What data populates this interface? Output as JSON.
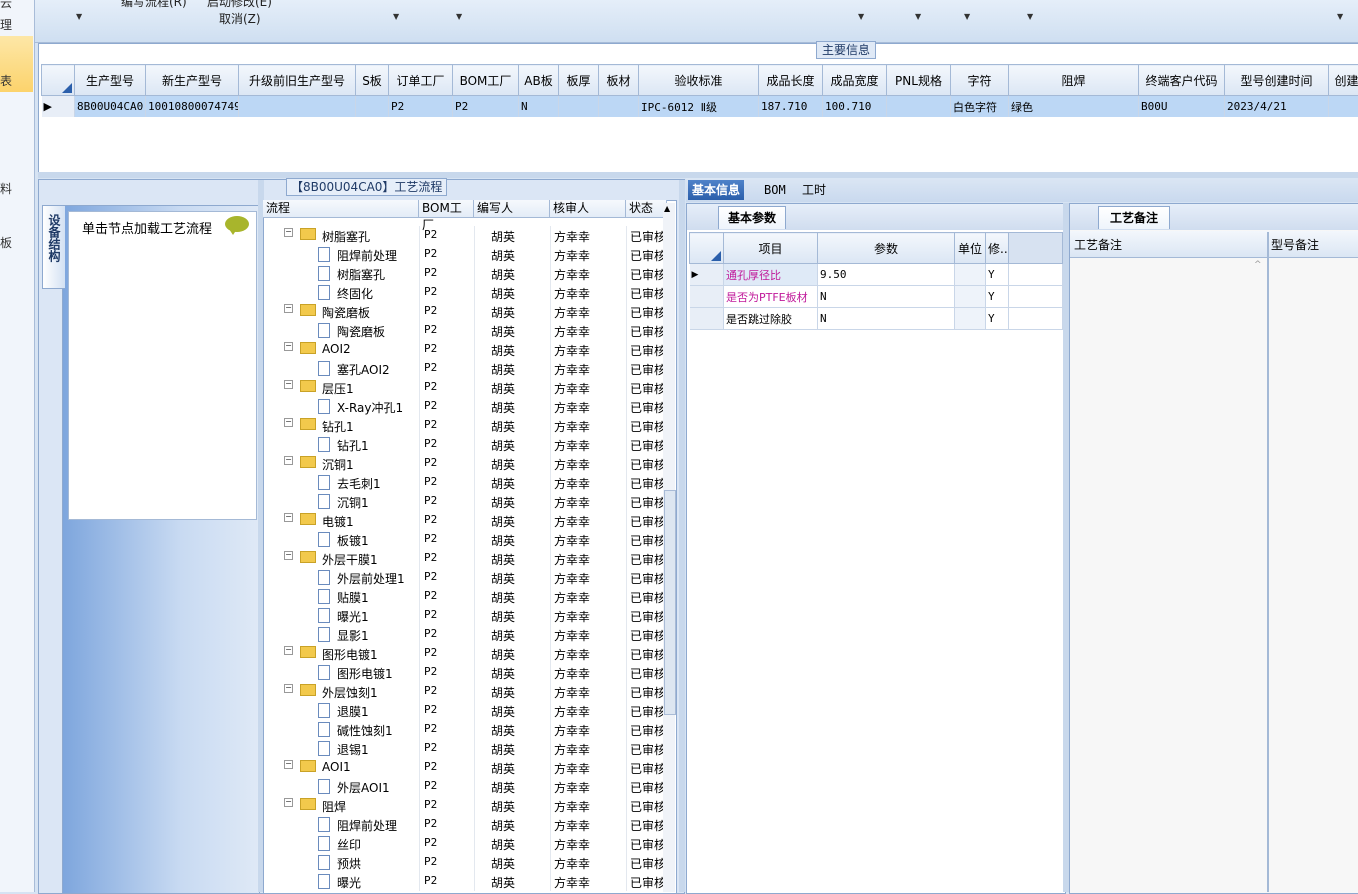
{
  "left_strip": {
    "items": [
      "云",
      "理",
      "表",
      "料",
      "板"
    ]
  },
  "toolbar": {
    "menu_edit_flow": "编写流程(R)",
    "menu_start_review": "启动修改(E)",
    "menu_cancel": "取消(Z)"
  },
  "main_info": {
    "legend": "主要信息",
    "columns": [
      "生产型号",
      "新生产型号",
      "升级前旧生产型号",
      "S板",
      "订单工厂",
      "BOM工厂",
      "AB板",
      "板厚",
      "板材",
      "验收标准",
      "成品长度",
      "成品宽度",
      "PNL规格",
      "字符",
      "阻焊",
      "终端客户代码",
      "型号创建时间",
      "创建"
    ],
    "rows": [
      [
        "8B00U04CA0",
        "10010800074749",
        "",
        "",
        "P2",
        "P2",
        "N",
        "",
        "",
        "IPC-6012 Ⅱ级",
        "187.710",
        "100.710",
        "",
        "白色字符",
        "绿色",
        "B00U",
        "2023/4/21",
        ""
      ]
    ]
  },
  "process": {
    "legend": "【8B00U04CA0】工艺流程",
    "device_tab": "设备结构",
    "device_hint": "单击节点加载工艺流程",
    "columns": [
      "流程",
      "BOM工厂",
      "编写人",
      "核审人",
      "状态"
    ],
    "rows": [
      {
        "type": "folder",
        "name": "树脂塞孔",
        "bom": "P2",
        "writer": "胡英",
        "reviewer": "方幸幸",
        "status": "已审核"
      },
      {
        "type": "file",
        "name": "阻焊前处理",
        "bom": "P2",
        "writer": "胡英",
        "reviewer": "方幸幸",
        "status": "已审核"
      },
      {
        "type": "file",
        "name": "树脂塞孔",
        "bom": "P2",
        "writer": "胡英",
        "reviewer": "方幸幸",
        "status": "已审核"
      },
      {
        "type": "file",
        "name": "终固化",
        "bom": "P2",
        "writer": "胡英",
        "reviewer": "方幸幸",
        "status": "已审核"
      },
      {
        "type": "folder",
        "name": "陶瓷磨板",
        "bom": "P2",
        "writer": "胡英",
        "reviewer": "方幸幸",
        "status": "已审核"
      },
      {
        "type": "file",
        "name": "陶瓷磨板",
        "bom": "P2",
        "writer": "胡英",
        "reviewer": "方幸幸",
        "status": "已审核"
      },
      {
        "type": "folder",
        "name": "AOI2",
        "bom": "P2",
        "writer": "胡英",
        "reviewer": "方幸幸",
        "status": "已审核"
      },
      {
        "type": "file",
        "name": "塞孔AOI2",
        "bom": "P2",
        "writer": "胡英",
        "reviewer": "方幸幸",
        "status": "已审核"
      },
      {
        "type": "folder",
        "name": "层压1",
        "bom": "P2",
        "writer": "胡英",
        "reviewer": "方幸幸",
        "status": "已审核"
      },
      {
        "type": "file",
        "name": "X-Ray冲孔1",
        "bom": "P2",
        "writer": "胡英",
        "reviewer": "方幸幸",
        "status": "已审核"
      },
      {
        "type": "folder",
        "name": "钻孔1",
        "bom": "P2",
        "writer": "胡英",
        "reviewer": "方幸幸",
        "status": "已审核"
      },
      {
        "type": "file",
        "name": "钻孔1",
        "bom": "P2",
        "writer": "胡英",
        "reviewer": "方幸幸",
        "status": "已审核"
      },
      {
        "type": "folder",
        "name": "沉铜1",
        "bom": "P2",
        "writer": "胡英",
        "reviewer": "方幸幸",
        "status": "已审核"
      },
      {
        "type": "file",
        "name": "去毛刺1",
        "bom": "P2",
        "writer": "胡英",
        "reviewer": "方幸幸",
        "status": "已审核"
      },
      {
        "type": "file",
        "name": "沉铜1",
        "bom": "P2",
        "writer": "胡英",
        "reviewer": "方幸幸",
        "status": "已审核"
      },
      {
        "type": "folder",
        "name": "电镀1",
        "bom": "P2",
        "writer": "胡英",
        "reviewer": "方幸幸",
        "status": "已审核"
      },
      {
        "type": "file",
        "name": "板镀1",
        "bom": "P2",
        "writer": "胡英",
        "reviewer": "方幸幸",
        "status": "已审核"
      },
      {
        "type": "folder",
        "name": "外层干膜1",
        "bom": "P2",
        "writer": "胡英",
        "reviewer": "方幸幸",
        "status": "已审核"
      },
      {
        "type": "file",
        "name": "外层前处理1",
        "bom": "P2",
        "writer": "胡英",
        "reviewer": "方幸幸",
        "status": "已审核"
      },
      {
        "type": "file",
        "name": "贴膜1",
        "bom": "P2",
        "writer": "胡英",
        "reviewer": "方幸幸",
        "status": "已审核"
      },
      {
        "type": "file",
        "name": "曝光1",
        "bom": "P2",
        "writer": "胡英",
        "reviewer": "方幸幸",
        "status": "已审核"
      },
      {
        "type": "file",
        "name": "显影1",
        "bom": "P2",
        "writer": "胡英",
        "reviewer": "方幸幸",
        "status": "已审核"
      },
      {
        "type": "folder",
        "name": "图形电镀1",
        "bom": "P2",
        "writer": "胡英",
        "reviewer": "方幸幸",
        "status": "已审核"
      },
      {
        "type": "file",
        "name": "图形电镀1",
        "bom": "P2",
        "writer": "胡英",
        "reviewer": "方幸幸",
        "status": "已审核"
      },
      {
        "type": "folder",
        "name": "外层蚀刻1",
        "bom": "P2",
        "writer": "胡英",
        "reviewer": "方幸幸",
        "status": "已审核"
      },
      {
        "type": "file",
        "name": "退膜1",
        "bom": "P2",
        "writer": "胡英",
        "reviewer": "方幸幸",
        "status": "已审核"
      },
      {
        "type": "file",
        "name": "碱性蚀刻1",
        "bom": "P2",
        "writer": "胡英",
        "reviewer": "方幸幸",
        "status": "已审核"
      },
      {
        "type": "file",
        "name": "退锡1",
        "bom": "P2",
        "writer": "胡英",
        "reviewer": "方幸幸",
        "status": "已审核"
      },
      {
        "type": "folder",
        "name": "AOI1",
        "bom": "P2",
        "writer": "胡英",
        "reviewer": "方幸幸",
        "status": "已审核"
      },
      {
        "type": "file",
        "name": "外层AOI1",
        "bom": "P2",
        "writer": "胡英",
        "reviewer": "方幸幸",
        "status": "已审核"
      },
      {
        "type": "folder",
        "name": "阻焊",
        "bom": "P2",
        "writer": "胡英",
        "reviewer": "方幸幸",
        "status": "已审核"
      },
      {
        "type": "file",
        "name": "阻焊前处理",
        "bom": "P2",
        "writer": "胡英",
        "reviewer": "方幸幸",
        "status": "已审核"
      },
      {
        "type": "file",
        "name": "丝印",
        "bom": "P2",
        "writer": "胡英",
        "reviewer": "方幸幸",
        "status": "已审核"
      },
      {
        "type": "file",
        "name": "预烘",
        "bom": "P2",
        "writer": "胡英",
        "reviewer": "方幸幸",
        "status": "已审核"
      },
      {
        "type": "file",
        "name": "曝光",
        "bom": "P2",
        "writer": "胡英",
        "reviewer": "方幸幸",
        "status": "已审核"
      }
    ]
  },
  "detail_tabs": {
    "basic": "基本信息",
    "bom": "BOM",
    "hours": "工时"
  },
  "basic_params": {
    "tab": "基本参数",
    "columns": [
      "项目",
      "参数",
      "单位",
      "修..."
    ],
    "rows": [
      {
        "item": "通孔厚径比",
        "param": "9.50",
        "unit": "",
        "mod": "Y"
      },
      {
        "item": "是否为PTFE板材",
        "param": "N",
        "unit": "",
        "mod": "Y"
      },
      {
        "item": "是否跳过除胶",
        "param": "N",
        "unit": "",
        "mod": "Y"
      }
    ]
  },
  "remarks": {
    "tab": "工艺备注",
    "col_process": "工艺备注",
    "col_model": "型号备注"
  },
  "colors": {
    "accent": "#2b5fab",
    "selected_row": "#bcd7f5",
    "param_item": "#c0189a"
  }
}
